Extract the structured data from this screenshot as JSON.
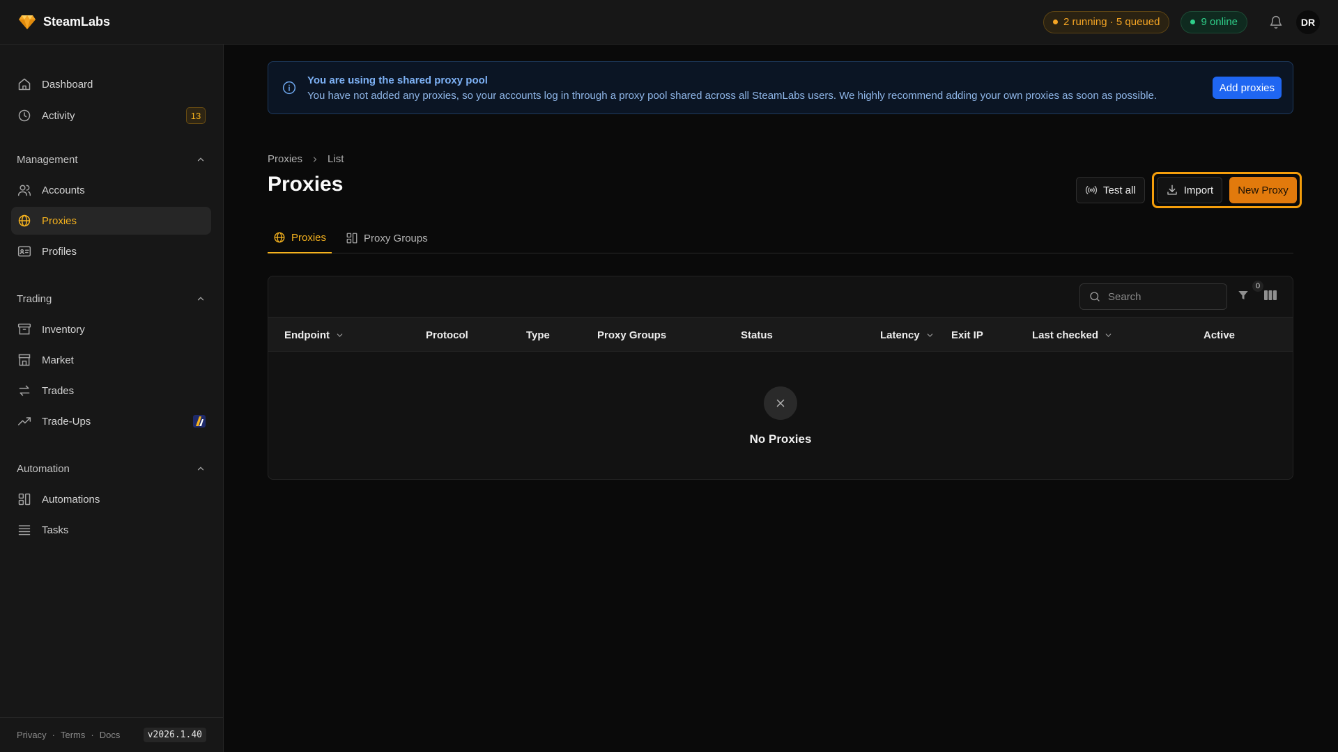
{
  "brand": {
    "name": "SteamLabs"
  },
  "header": {
    "jobs_status": "2 running · 5 queued",
    "online_status": "9 online",
    "avatar_initials": "DR",
    "colors": {
      "amber": "#f5a524",
      "green": "#2fd08a"
    }
  },
  "sidebar": {
    "top_items": [
      {
        "label": "Dashboard",
        "icon": "home-icon"
      },
      {
        "label": "Activity",
        "icon": "clock-icon",
        "badge": "13"
      }
    ],
    "sections": [
      {
        "title": "Management",
        "items": [
          {
            "label": "Accounts",
            "icon": "users-icon"
          },
          {
            "label": "Proxies",
            "icon": "globe-icon",
            "active": true
          },
          {
            "label": "Profiles",
            "icon": "id-card-icon"
          }
        ]
      },
      {
        "title": "Trading",
        "items": [
          {
            "label": "Inventory",
            "icon": "archive-icon"
          },
          {
            "label": "Market",
            "icon": "store-icon"
          },
          {
            "label": "Trades",
            "icon": "arrows-exchange-icon"
          },
          {
            "label": "Trade-Ups",
            "icon": "trending-up-icon"
          }
        ]
      },
      {
        "title": "Automation",
        "items": [
          {
            "label": "Automations",
            "icon": "workflow-icon"
          },
          {
            "label": "Tasks",
            "icon": "list-icon"
          }
        ]
      }
    ],
    "footer": {
      "privacy": "Privacy",
      "terms": "Terms",
      "docs": "Docs",
      "version": "v2026.1.40"
    }
  },
  "alert": {
    "title": "You are using the shared proxy pool",
    "message": "You have not added any proxies, so your accounts log in through a proxy pool shared across all SteamLabs users. We highly recommend adding your own proxies as soon as possible.",
    "action": "Add proxies"
  },
  "breadcrumb": [
    "Proxies",
    "List"
  ],
  "page": {
    "title": "Proxies",
    "actions": {
      "test_all": "Test all",
      "import": "Import",
      "new_proxy": "New Proxy"
    }
  },
  "tabs": [
    {
      "label": "Proxies",
      "active": true
    },
    {
      "label": "Proxy Groups",
      "active": false
    }
  ],
  "table": {
    "search_placeholder": "Search",
    "filter_count": "0",
    "columns": [
      "Endpoint",
      "Protocol",
      "Type",
      "Proxy Groups",
      "Status",
      "Latency",
      "Exit IP",
      "Last checked",
      "Active"
    ],
    "empty_text": "No Proxies"
  }
}
